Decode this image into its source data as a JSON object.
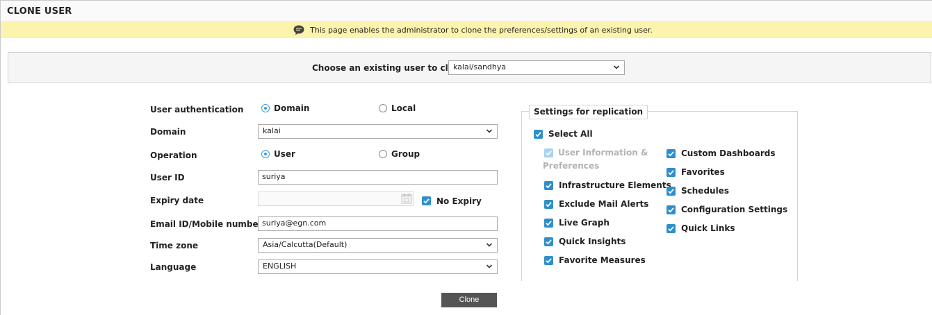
{
  "header": {
    "title": "CLONE USER"
  },
  "info": {
    "icon": "speech-bubble-icon",
    "text": "This page enables the administrator to clone the preferences/settings of an existing user."
  },
  "choose": {
    "label": "Choose an existing user to clone",
    "selected": "kalai/sandhya"
  },
  "form": {
    "auth": {
      "label": "User authentication",
      "options": [
        "Domain",
        "Local"
      ],
      "selected": "Domain"
    },
    "domain": {
      "label": "Domain",
      "selected": "kalai"
    },
    "operation": {
      "label": "Operation",
      "options": [
        "User",
        "Group"
      ],
      "selected": "User"
    },
    "userid": {
      "label": "User ID",
      "value": "suriya"
    },
    "expiry": {
      "label": "Expiry date",
      "value": "",
      "no_expiry_label": "No Expiry",
      "no_expiry_checked": true
    },
    "email": {
      "label": "Email ID/Mobile number",
      "value": "suriya@egn.com"
    },
    "timezone": {
      "label": "Time zone",
      "selected": "Asia/Calcutta(Default)"
    },
    "language": {
      "label": "Language",
      "selected": "ENGLISH"
    }
  },
  "replication": {
    "title": "Settings for replication",
    "select_all": "Select All",
    "left_items": [
      {
        "label_line1": "User Information &",
        "label_line2": "Preferences",
        "disabled": true
      },
      {
        "label": "Infrastructure Elements"
      },
      {
        "label": "Exclude Mail Alerts"
      },
      {
        "label": "Live Graph"
      },
      {
        "label": "Quick Insights"
      },
      {
        "label": "Favorite Measures"
      }
    ],
    "right_items": [
      {
        "label": "Custom Dashboards"
      },
      {
        "label": "Favorites"
      },
      {
        "label": "Schedules"
      },
      {
        "label": "Configuration Settings"
      },
      {
        "label": "Quick Links"
      }
    ]
  },
  "actions": {
    "clone_label": "Clone"
  },
  "colors": {
    "accent": "#2e8fcc",
    "info_bg": "#fcf3ac",
    "button_bg": "#555555"
  }
}
